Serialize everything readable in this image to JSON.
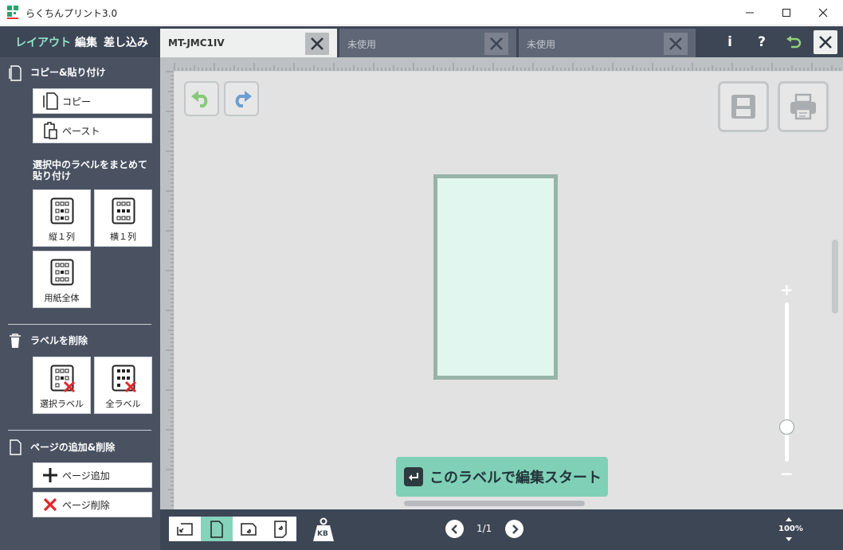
{
  "app": {
    "title": "らくちんプリント3.0"
  },
  "toolbar": {
    "modes": [
      "レイアウト",
      "編集",
      "差し込み"
    ],
    "tabs": [
      {
        "label": "MT-JMC1IV",
        "active": true
      },
      {
        "label": "未使用",
        "active": false
      },
      {
        "label": "未使用",
        "active": false
      }
    ],
    "info_label": "i",
    "help_label": "?"
  },
  "sidebar": {
    "copy_section": {
      "title": "コピー&貼り付け",
      "copy_label": "コピー",
      "paste_label": "ペースト"
    },
    "bulk_paste": {
      "title_line1": "選択中のラベルをまとめて",
      "title_line2": "貼り付け",
      "vertical_label": "縦１列",
      "horizontal_label": "横１列",
      "whole_label": "用紙全体"
    },
    "delete_section": {
      "title": "ラベルを削除",
      "selected_label": "選択ラベル",
      "all_label": "全ラベル"
    },
    "page_section": {
      "title": "ページの追加&削除",
      "add_label": "ページ追加",
      "delete_label": "ページ削除"
    }
  },
  "canvas": {
    "start_button_label": "このラベルで編集スタート",
    "zoom_plus": "+",
    "zoom_minus": "−",
    "zoom_level": 0.22
  },
  "bottom": {
    "page_indicator": "1/1",
    "zoom_label": "100%",
    "kb_label": "KB"
  },
  "colors": {
    "accent": "#86d3bb",
    "toolbar": "#3d4655",
    "sidebar": "#4a5262",
    "delete_red": "#e0262a"
  }
}
